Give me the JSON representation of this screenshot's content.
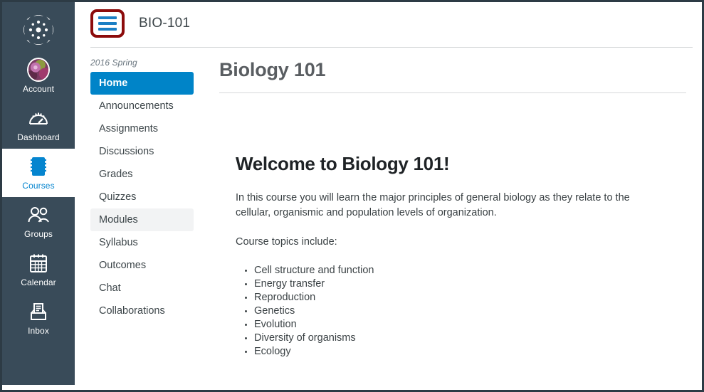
{
  "global_nav": {
    "logo": {
      "name": "canvas-logo"
    },
    "items": [
      {
        "label": "Account",
        "icon": "user-avatar-icon",
        "active": false
      },
      {
        "label": "Dashboard",
        "icon": "dashboard-speedometer-icon",
        "active": false
      },
      {
        "label": "Courses",
        "icon": "courses-book-icon",
        "active": true
      },
      {
        "label": "Groups",
        "icon": "groups-people-icon",
        "active": false
      },
      {
        "label": "Calendar",
        "icon": "calendar-icon",
        "active": false
      },
      {
        "label": "Inbox",
        "icon": "inbox-tray-icon",
        "active": false
      }
    ]
  },
  "header": {
    "menu_toggle": {
      "name": "course-menu-hamburger-icon",
      "highlight_color": "#8c0b0b",
      "bar_color": "#1b7fc4"
    },
    "breadcrumb_course": "BIO-101"
  },
  "course_nav": {
    "term": "2016 Spring",
    "items": [
      {
        "label": "Home",
        "state": "active"
      },
      {
        "label": "Announcements",
        "state": "normal"
      },
      {
        "label": "Assignments",
        "state": "normal"
      },
      {
        "label": "Discussions",
        "state": "normal"
      },
      {
        "label": "Grades",
        "state": "normal"
      },
      {
        "label": "Quizzes",
        "state": "normal"
      },
      {
        "label": "Modules",
        "state": "hovered"
      },
      {
        "label": "Syllabus",
        "state": "normal"
      },
      {
        "label": "Outcomes",
        "state": "normal"
      },
      {
        "label": "Chat",
        "state": "normal"
      },
      {
        "label": "Collaborations",
        "state": "normal"
      }
    ]
  },
  "content": {
    "page_title": "Biology 101",
    "welcome_heading": "Welcome to Biology 101!",
    "paragraph_1": "In this course you will learn the major principles of general biology as they relate to the cellular, organismic and population levels of organization.",
    "paragraph_2": "Course topics include:",
    "topics": [
      "Cell structure and function",
      "Energy transfer",
      "Reproduction",
      "Genetics",
      "Evolution",
      "Diversity of organisms",
      "Ecology"
    ]
  },
  "colors": {
    "global_nav_bg": "#394b59",
    "active_link_blue": "#0084c8",
    "courses_active_blue": "#0585cf",
    "hover_gray": "#f2f3f4",
    "highlight_red": "#8c0b0b",
    "window_border": "#2d3b45"
  }
}
